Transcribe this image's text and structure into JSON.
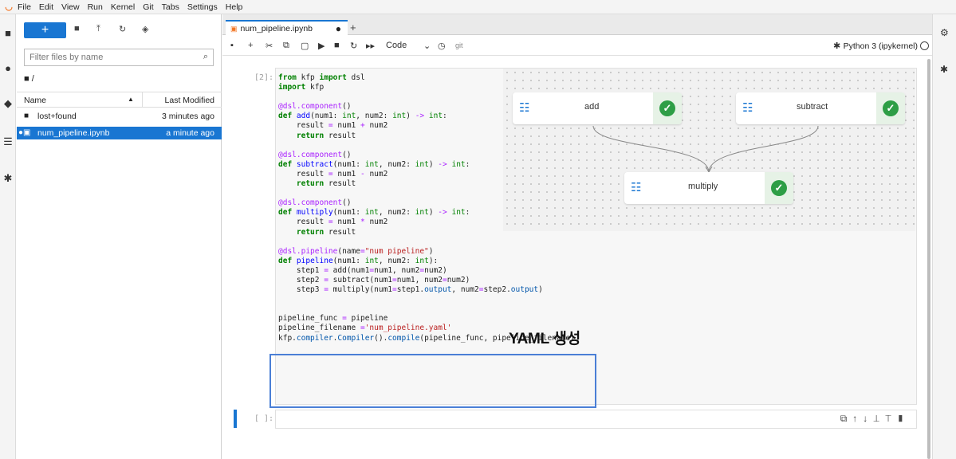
{
  "menu": [
    "File",
    "Edit",
    "View",
    "Run",
    "Kernel",
    "Git",
    "Tabs",
    "Settings",
    "Help"
  ],
  "filebrowser": {
    "new_label": "+",
    "filter_placeholder": "Filter files by name",
    "breadcrumb": "/",
    "col_name": "Name",
    "col_modified": "Last Modified",
    "files": [
      {
        "name": "lost+found",
        "modified": "3 minutes ago",
        "icon": "folder-icon"
      },
      {
        "name": "num_pipeline.ipynb",
        "modified": "a minute ago",
        "icon": "notebook-icon",
        "selected": true
      }
    ]
  },
  "tab": {
    "title": "num_pipeline.ipynb"
  },
  "toolbar": {
    "cell_type": "Code",
    "git_label": "git",
    "kernel": "Python 3 (ipykernel)"
  },
  "cell1": {
    "prompt": "[2]:"
  },
  "cell2": {
    "prompt": "[ ]:"
  },
  "graph": {
    "nodes": [
      "add",
      "subtract",
      "multiply"
    ],
    "status": "succeeded",
    "accent": "#2e9e46"
  },
  "annotation": "YAML 생성",
  "colors": {
    "brand": "#1976d2",
    "success": "#2e9e46",
    "highlight": "#4a7fd6"
  }
}
